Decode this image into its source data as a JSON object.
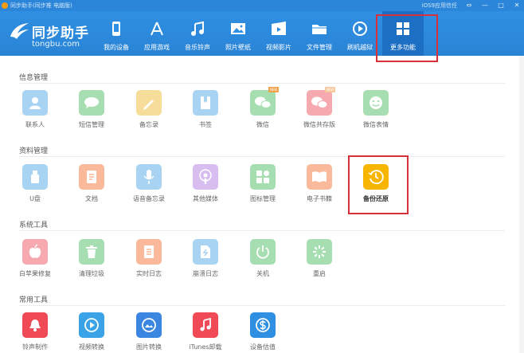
{
  "window": {
    "title": "同步助手(同步推 电脑版)",
    "ios_trust": "iOS9应用信任",
    "controls": [
      "⇔",
      "—",
      "□",
      "✕"
    ]
  },
  "brand": {
    "name_cn": "同步助手",
    "name_en": "tongbu.com"
  },
  "nav": [
    {
      "label": "我的设备",
      "icon": "phone-icon"
    },
    {
      "label": "应用游戏",
      "icon": "app-store-icon"
    },
    {
      "label": "音乐铃声",
      "icon": "music-note-icon"
    },
    {
      "label": "照片壁纸",
      "icon": "picture-icon"
    },
    {
      "label": "视频影片",
      "icon": "film-icon"
    },
    {
      "label": "文件管理",
      "icon": "folder-icon"
    },
    {
      "label": "刷机越狱",
      "icon": "flash-icon"
    },
    {
      "label": "更多功能",
      "icon": "grid-icon"
    }
  ],
  "sections": [
    {
      "title": "信息管理",
      "items": [
        {
          "label": "联系人",
          "icon": "contact-icon",
          "color": "#a9d3f2"
        },
        {
          "label": "短信管理",
          "icon": "sms-icon",
          "color": "#a7deb1"
        },
        {
          "label": "备忘录",
          "icon": "memo-icon",
          "color": "#f7dd9a"
        },
        {
          "label": "书签",
          "icon": "bookmark-icon",
          "color": "#a9d3f2"
        },
        {
          "label": "微信",
          "icon": "wechat-icon",
          "color": "#a7deb1",
          "badge": "new"
        },
        {
          "label": "微信共存版",
          "icon": "wechat-icon",
          "color": "#f7a9b0",
          "badge": "new"
        },
        {
          "label": "微信表情",
          "icon": "emoji-icon",
          "color": "#a7deb1"
        }
      ]
    },
    {
      "title": "资料管理",
      "items": [
        {
          "label": "U盘",
          "icon": "usb-drive-icon",
          "color": "#a9d3f2"
        },
        {
          "label": "文档",
          "icon": "document-icon",
          "color": "#f9b99a"
        },
        {
          "label": "语音备忘录",
          "icon": "microphone-icon",
          "color": "#a9d3f2"
        },
        {
          "label": "其他媒体",
          "icon": "podcast-icon",
          "color": "#d7bdf0"
        },
        {
          "label": "图标管理",
          "icon": "icon-grid-icon",
          "color": "#a7deb1"
        },
        {
          "label": "电子书籍",
          "icon": "book-icon",
          "color": "#f9b99a"
        },
        {
          "label": "备份还原",
          "icon": "backup-clock-icon",
          "color": "#f7b500"
        }
      ]
    },
    {
      "title": "系统工具",
      "items": [
        {
          "label": "白苹果修复",
          "icon": "apple-fix-icon",
          "color": "#f7a9b0"
        },
        {
          "label": "清理垃圾",
          "icon": "trash-icon",
          "color": "#a7deb1"
        },
        {
          "label": "实时日志",
          "icon": "log-icon",
          "color": "#f9b99a"
        },
        {
          "label": "崩溃日志",
          "icon": "crash-log-icon",
          "color": "#a9d3f2"
        },
        {
          "label": "关机",
          "icon": "power-icon",
          "color": "#a7deb1"
        },
        {
          "label": "重启",
          "icon": "restart-icon",
          "color": "#a7deb1"
        }
      ]
    },
    {
      "title": "常用工具",
      "items": [
        {
          "label": "铃声制作",
          "icon": "bell-icon",
          "color": "#ef4a55"
        },
        {
          "label": "视频转换",
          "icon": "play-icon",
          "color": "#3aa3e8"
        },
        {
          "label": "图片转换",
          "icon": "image-convert-icon",
          "color": "#3a86e0"
        },
        {
          "label": "iTunes卸载",
          "icon": "itunes-icon",
          "color": "#ef4a55"
        },
        {
          "label": "设备估值",
          "icon": "dollar-icon",
          "color": "#2f8fe2"
        }
      ]
    }
  ],
  "colors": {
    "titlebar": "#2b86d9",
    "toolbar": "#2f8fe2",
    "highlight": "#d8303a"
  }
}
